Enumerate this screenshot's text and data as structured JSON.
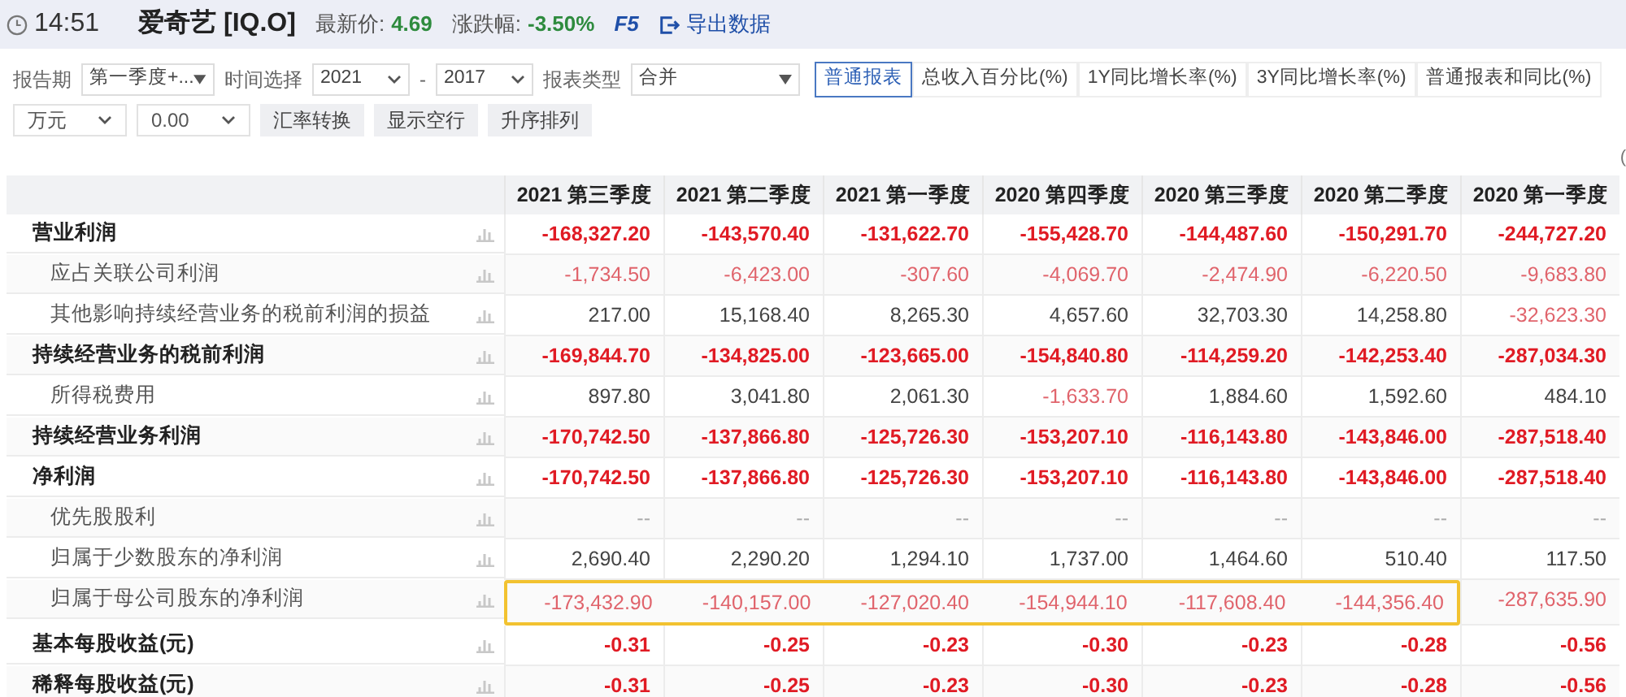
{
  "header": {
    "time": "14:51",
    "stock": "爱奇艺 [IQ.O]",
    "price_label": "最新价:",
    "price": "4.69",
    "change_label": "涨跌幅:",
    "change": "-3.50%",
    "refresh": "F5",
    "export": "导出数据"
  },
  "filters": [
    {
      "kind": "label",
      "text": "报告期"
    },
    {
      "kind": "select",
      "value": "第一季度+..."
    },
    {
      "kind": "label",
      "text": "时间选择"
    },
    {
      "kind": "select",
      "value": "2021"
    },
    {
      "kind": "label",
      "text": "-"
    },
    {
      "kind": "select",
      "value": "2017"
    },
    {
      "kind": "label",
      "text": "报表类型"
    },
    {
      "kind": "select",
      "value": "合并"
    }
  ],
  "views": [
    {
      "label": "普通报表",
      "selected": true
    },
    {
      "label": "总收入百分比(%)",
      "selected": false
    },
    {
      "label": "1Y同比增长率(%)",
      "selected": false
    },
    {
      "label": "3Y同比增长率(%)",
      "selected": false
    },
    {
      "label": "普通报表和同比(%)",
      "selected": false
    }
  ],
  "options": [
    {
      "kind": "select",
      "value": "万元"
    },
    {
      "kind": "select",
      "value": "0.00"
    },
    {
      "kind": "button",
      "text": "汇率转换"
    },
    {
      "kind": "button",
      "text": "显示空行"
    },
    {
      "kind": "button",
      "text": "升序排列"
    }
  ],
  "unit_note": "(",
  "table": {
    "columns": [
      "2021 第三季度",
      "2021 第二季度",
      "2021 第一季度",
      "2020 第四季度",
      "2020 第三季度",
      "2020 第二季度",
      "2020 第一季度"
    ],
    "rows": [
      {
        "label": "营业利润",
        "kind": "total",
        "values": [
          {
            "text": "-168,327.20",
            "negative": true
          },
          {
            "text": "-143,570.40",
            "negative": true
          },
          {
            "text": "-131,622.70",
            "negative": true
          },
          {
            "text": "-155,428.70",
            "negative": true
          },
          {
            "text": "-144,487.60",
            "negative": true
          },
          {
            "text": "-150,291.70",
            "negative": true
          },
          {
            "text": "-244,727.20",
            "negative": true
          }
        ]
      },
      {
        "label": "应占关联公司利润",
        "kind": "item",
        "values": [
          {
            "text": "-1,734.50",
            "negative": true
          },
          {
            "text": "-6,423.00",
            "negative": true
          },
          {
            "text": "-307.60",
            "negative": true
          },
          {
            "text": "-4,069.70",
            "negative": true
          },
          {
            "text": "-2,474.90",
            "negative": true
          },
          {
            "text": "-6,220.50",
            "negative": true
          },
          {
            "text": "-9,683.80",
            "negative": true
          }
        ]
      },
      {
        "label": "其他影响持续经营业务的税前利润的损益",
        "kind": "item",
        "values": [
          {
            "text": "217.00",
            "negative": false
          },
          {
            "text": "15,168.40",
            "negative": false
          },
          {
            "text": "8,265.30",
            "negative": false
          },
          {
            "text": "4,657.60",
            "negative": false
          },
          {
            "text": "32,703.30",
            "negative": false
          },
          {
            "text": "14,258.80",
            "negative": false
          },
          {
            "text": "-32,623.30",
            "negative": true
          }
        ]
      },
      {
        "label": "持续经营业务的税前利润",
        "kind": "total",
        "values": [
          {
            "text": "-169,844.70",
            "negative": true
          },
          {
            "text": "-134,825.00",
            "negative": true
          },
          {
            "text": "-123,665.00",
            "negative": true
          },
          {
            "text": "-154,840.80",
            "negative": true
          },
          {
            "text": "-114,259.20",
            "negative": true
          },
          {
            "text": "-142,253.40",
            "negative": true
          },
          {
            "text": "-287,034.30",
            "negative": true
          }
        ]
      },
      {
        "label": "所得税费用",
        "kind": "item",
        "values": [
          {
            "text": "897.80",
            "negative": false
          },
          {
            "text": "3,041.80",
            "negative": false
          },
          {
            "text": "2,061.30",
            "negative": false
          },
          {
            "text": "-1,633.70",
            "negative": true
          },
          {
            "text": "1,884.60",
            "negative": false
          },
          {
            "text": "1,592.60",
            "negative": false
          },
          {
            "text": "484.10",
            "negative": false
          }
        ]
      },
      {
        "label": "持续经营业务利润",
        "kind": "total",
        "values": [
          {
            "text": "-170,742.50",
            "negative": true
          },
          {
            "text": "-137,866.80",
            "negative": true
          },
          {
            "text": "-125,726.30",
            "negative": true
          },
          {
            "text": "-153,207.10",
            "negative": true
          },
          {
            "text": "-116,143.80",
            "negative": true
          },
          {
            "text": "-143,846.00",
            "negative": true
          },
          {
            "text": "-287,518.40",
            "negative": true
          }
        ]
      },
      {
        "label": "净利润",
        "kind": "total",
        "values": [
          {
            "text": "-170,742.50",
            "negative": true
          },
          {
            "text": "-137,866.80",
            "negative": true
          },
          {
            "text": "-125,726.30",
            "negative": true
          },
          {
            "text": "-153,207.10",
            "negative": true
          },
          {
            "text": "-116,143.80",
            "negative": true
          },
          {
            "text": "-143,846.00",
            "negative": true
          },
          {
            "text": "-287,518.40",
            "negative": true
          }
        ]
      },
      {
        "label": "优先股股利",
        "kind": "item",
        "values": [
          {
            "text": "--",
            "negative": false
          },
          {
            "text": "--",
            "negative": false
          },
          {
            "text": "--",
            "negative": false
          },
          {
            "text": "--",
            "negative": false
          },
          {
            "text": "--",
            "negative": false
          },
          {
            "text": "--",
            "negative": false
          },
          {
            "text": "--",
            "negative": false
          }
        ]
      },
      {
        "label": "归属于少数股东的净利润",
        "kind": "item",
        "values": [
          {
            "text": "2,690.40",
            "negative": false
          },
          {
            "text": "2,290.20",
            "negative": false
          },
          {
            "text": "1,294.10",
            "negative": false
          },
          {
            "text": "1,737.00",
            "negative": false
          },
          {
            "text": "1,464.60",
            "negative": false
          },
          {
            "text": "510.40",
            "negative": false
          },
          {
            "text": "117.50",
            "negative": false
          }
        ]
      },
      {
        "label": "归属于母公司股东的净利润",
        "kind": "item",
        "highlighted_values": [
          {
            "text": "-173,432.90",
            "negative": true
          },
          {
            "text": "-140,157.00",
            "negative": true
          },
          {
            "text": "-127,020.40",
            "negative": true
          },
          {
            "text": "-154,944.10",
            "negative": true
          },
          {
            "text": "-117,608.40",
            "negative": true
          },
          {
            "text": "-144,356.40",
            "negative": true
          }
        ],
        "values": [
          {
            "text": "-287,635.90",
            "negative": true
          }
        ]
      },
      {
        "label": "基本每股收益(元)",
        "kind": "total",
        "values": [
          {
            "text": "-0.31",
            "negative": true
          },
          {
            "text": "-0.25",
            "negative": true
          },
          {
            "text": "-0.23",
            "negative": true
          },
          {
            "text": "-0.30",
            "negative": true
          },
          {
            "text": "-0.23",
            "negative": true
          },
          {
            "text": "-0.28",
            "negative": true
          },
          {
            "text": "-0.56",
            "negative": true
          }
        ]
      },
      {
        "label": "稀释每股收益(元)",
        "kind": "total",
        "values": [
          {
            "text": "-0.31",
            "negative": true
          },
          {
            "text": "-0.25",
            "negative": true
          },
          {
            "text": "-0.23",
            "negative": true
          },
          {
            "text": "-0.30",
            "negative": true
          },
          {
            "text": "-0.23",
            "negative": true
          },
          {
            "text": "-0.28",
            "negative": true
          },
          {
            "text": "-0.56",
            "negative": true
          }
        ]
      }
    ]
  }
}
